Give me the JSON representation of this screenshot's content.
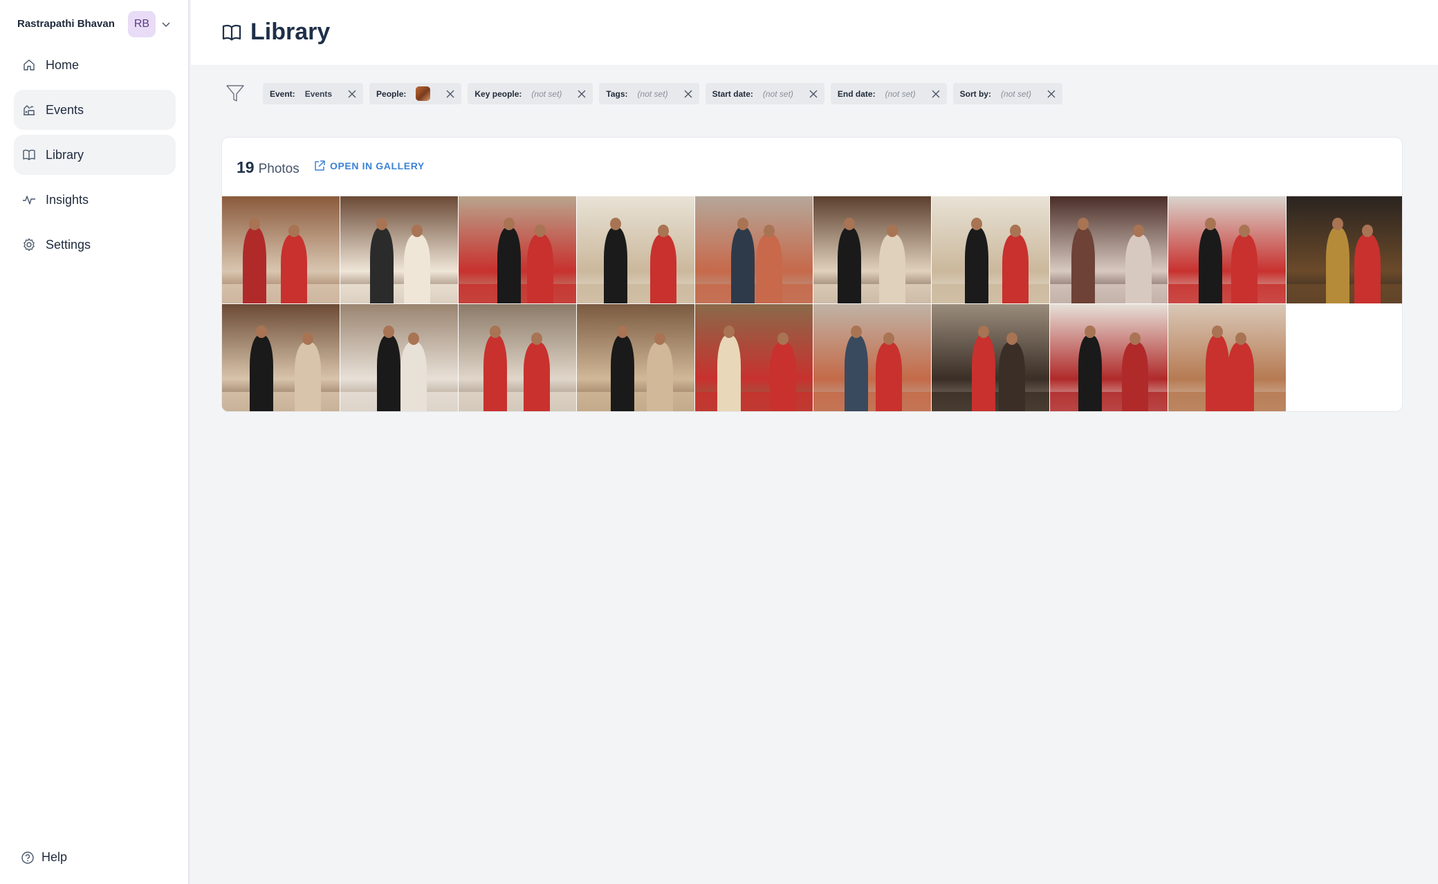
{
  "sidebar": {
    "org_name": "Rastrapathi Bhavan",
    "avatar_initials": "RB",
    "items": [
      {
        "label": "Home",
        "icon": "home-icon",
        "active": false
      },
      {
        "label": "Events",
        "icon": "events-icon",
        "active": true
      },
      {
        "label": "Library",
        "icon": "book-icon",
        "active": true
      },
      {
        "label": "Insights",
        "icon": "activity-icon",
        "active": false
      },
      {
        "label": "Settings",
        "icon": "gear-icon",
        "active": false
      }
    ],
    "help_label": "Help"
  },
  "header": {
    "title": "Library",
    "icon": "book-icon"
  },
  "filters": {
    "event": {
      "label": "Event:",
      "value": "Events"
    },
    "people": {
      "label": "People:",
      "value_icon": "person-thumbnail"
    },
    "key_people": {
      "label": "Key people:",
      "value": "(not set)"
    },
    "tags": {
      "label": "Tags:",
      "value": "(not set)"
    },
    "start_date": {
      "label": "Start date:",
      "value": "(not set)"
    },
    "end_date": {
      "label": "End date:",
      "value": "(not set)"
    },
    "sort_by": {
      "label": "Sort by:",
      "value": "(not set)"
    }
  },
  "library": {
    "photo_count": "19",
    "photo_count_label": "Photos",
    "open_gallery_label": "OPEN IN GALLERY"
  },
  "photos": [
    {
      "name": "photo-1",
      "scene": "hall-group",
      "colors": [
        "#8a5a3c",
        "#d9c6b0",
        "#b02a2a"
      ]
    },
    {
      "name": "photo-2",
      "scene": "banquet",
      "colors": [
        "#6b4a36",
        "#efe6d8",
        "#2b2b2b"
      ]
    },
    {
      "name": "photo-3",
      "scene": "portrait-closeup",
      "colors": [
        "#b9a48c",
        "#c8312e",
        "#1a1a1a"
      ]
    },
    {
      "name": "photo-4",
      "scene": "arch-walk",
      "colors": [
        "#e8e2d6",
        "#cbb89c",
        "#1b1b1b"
      ]
    },
    {
      "name": "photo-5",
      "scene": "guard-parade",
      "colors": [
        "#b5a79a",
        "#c7694a",
        "#2e3a4a"
      ]
    },
    {
      "name": "photo-6",
      "scene": "seated-lamp",
      "colors": [
        "#5c3f2e",
        "#e0d1bd",
        "#1a1a1a"
      ]
    },
    {
      "name": "photo-7",
      "scene": "arch-walk",
      "colors": [
        "#e8e2d6",
        "#cbb89c",
        "#1b1b1b"
      ]
    },
    {
      "name": "photo-8",
      "scene": "chandelier-room",
      "colors": [
        "#4a2e28",
        "#d8c9c0",
        "#6e4236"
      ]
    },
    {
      "name": "photo-9",
      "scene": "standing-pair",
      "colors": [
        "#d9d3cc",
        "#c8312e",
        "#1a1a1a"
      ]
    },
    {
      "name": "photo-10",
      "scene": "audience",
      "colors": [
        "#2a2420",
        "#6b4a2a",
        "#b58b3a"
      ]
    },
    {
      "name": "photo-11",
      "scene": "seated-lamp",
      "colors": [
        "#6b4a36",
        "#d8c4aa",
        "#1a1a1a"
      ]
    },
    {
      "name": "photo-12",
      "scene": "standing-pair",
      "colors": [
        "#9a8470",
        "#e8e1d8",
        "#1a1a1a"
      ]
    },
    {
      "name": "photo-13",
      "scene": "leaders-pose",
      "colors": [
        "#8c7a68",
        "#e0d6c9",
        "#c8312e"
      ]
    },
    {
      "name": "photo-14",
      "scene": "exhibit",
      "colors": [
        "#7a5a40",
        "#d0b898",
        "#1a1a1a"
      ]
    },
    {
      "name": "photo-15",
      "scene": "seated-chat",
      "colors": [
        "#8a6a4a",
        "#c8312e",
        "#e8d7b8"
      ]
    },
    {
      "name": "photo-16",
      "scene": "guard-parade",
      "colors": [
        "#c0b3a6",
        "#c46a48",
        "#394a5e"
      ]
    },
    {
      "name": "photo-17",
      "scene": "standing-pair",
      "colors": [
        "#9a8c7c",
        "#3a2e26",
        "#c8312e"
      ]
    },
    {
      "name": "photo-18",
      "scene": "ceremony-hall",
      "colors": [
        "#e6e0d8",
        "#b02a2a",
        "#1a1a1a"
      ]
    },
    {
      "name": "photo-19",
      "scene": "palace-exterior",
      "colors": [
        "#d9c8b8",
        "#b67a52",
        "#c8312e"
      ]
    }
  ],
  "theme": {
    "accent": "#3b82d6",
    "avatar_bg": "#e9dcf6",
    "active_nav_bg": "#f1f3f5",
    "chip_bg": "#e7e9ed"
  }
}
